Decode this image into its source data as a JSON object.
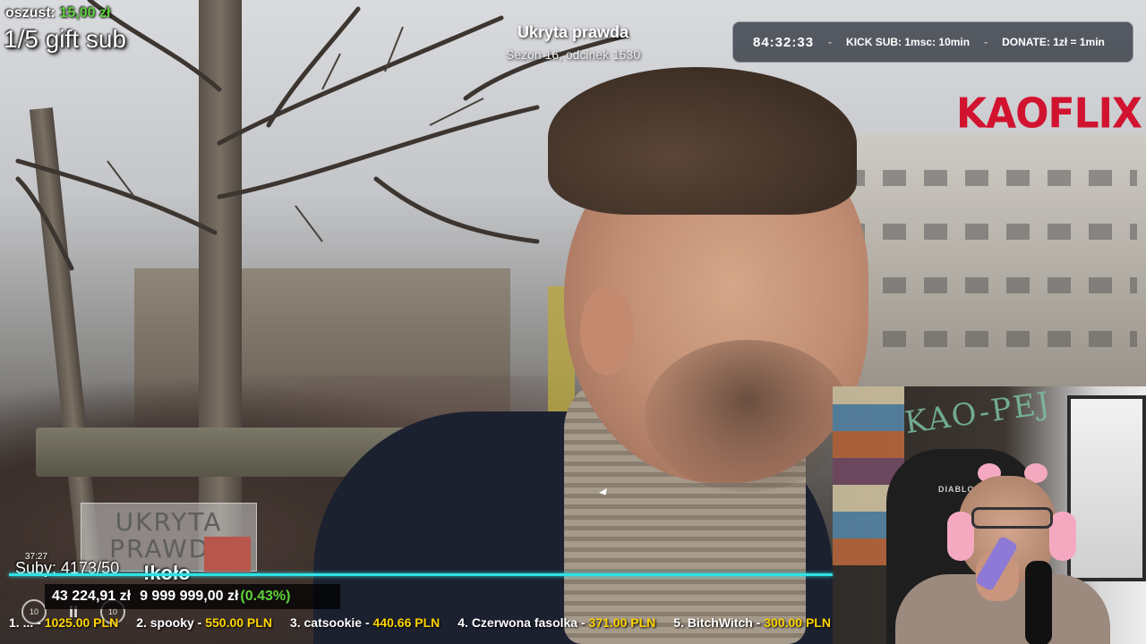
{
  "overlay": {
    "last_donor_label": "oszust:",
    "last_donor_amount": "15,00 zł",
    "gift_goal": "1/5 gift sub"
  },
  "show": {
    "title": "Ukryta prawda",
    "episode": "Sezon 16, odcinek 1530"
  },
  "timer": {
    "time": "84:32:33",
    "kick_sub": "KICK SUB: 1msc: 10min",
    "donate": "DONATE: 1zł = 1min"
  },
  "brand": "KAOFLIX",
  "video_logo": {
    "line1": "UKRYTA",
    "line2": "PRAWDA"
  },
  "webcam": {
    "wall_text": "KAO-PEJ",
    "chair_label": "DIABLO"
  },
  "player": {
    "small_time": "37:27",
    "subs": "Suby: 4173/50",
    "command": "!koło",
    "rewind_label": "10",
    "forward_label": "10",
    "pause_symbol": "II"
  },
  "donations": {
    "collected": "43 224,91 zł",
    "target": "9 999 999,00 zł",
    "percent": "(0.43%)"
  },
  "leaderboard": [
    {
      "name": "1. ... - ",
      "amount": "1025.00 PLN"
    },
    {
      "name": "2. spooky - ",
      "amount": "550.00 PLN"
    },
    {
      "name": "3. catsookie - ",
      "amount": "440.66 PLN"
    },
    {
      "name": "4. Czerwona fasolka - ",
      "amount": "371.00 PLN"
    },
    {
      "name": "5. BitchWitch - ",
      "amount": "300.00 PLN"
    }
  ],
  "colors": {
    "accent_green": "#5ed23a",
    "accent_yellow": "#ffd400",
    "progress_cyan": "#2ee2e6",
    "brand_red": "#d1132f"
  }
}
